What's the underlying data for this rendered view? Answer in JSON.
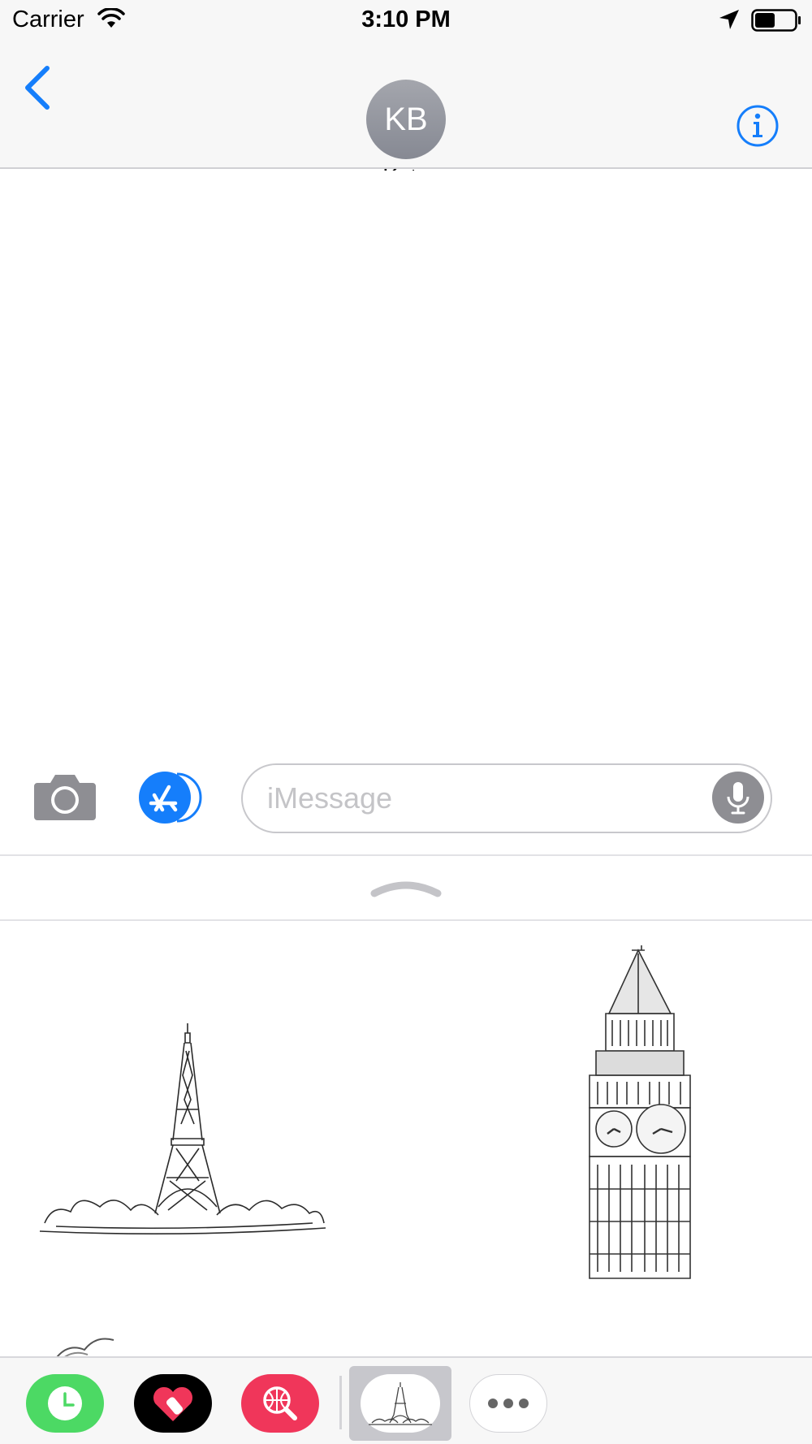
{
  "status_bar": {
    "carrier": "Carrier",
    "time": "3:10 PM",
    "battery_level": 0.5
  },
  "header": {
    "avatar_initials": "KB",
    "contact_name": "Kate"
  },
  "compose": {
    "placeholder": "iMessage"
  },
  "colors": {
    "ios_blue": "#157efb",
    "green_app": "#4cd964",
    "pink_app": "#f0365a",
    "gray_icon": "#8e8e93"
  },
  "stickers": [
    {
      "name": "eiffel-tower-sticker"
    },
    {
      "name": "big-ben-sticker"
    }
  ],
  "tray_apps": [
    "recents-app",
    "hearts-app",
    "search-images-app",
    "eiffel-sticker-app",
    "more-apps"
  ]
}
